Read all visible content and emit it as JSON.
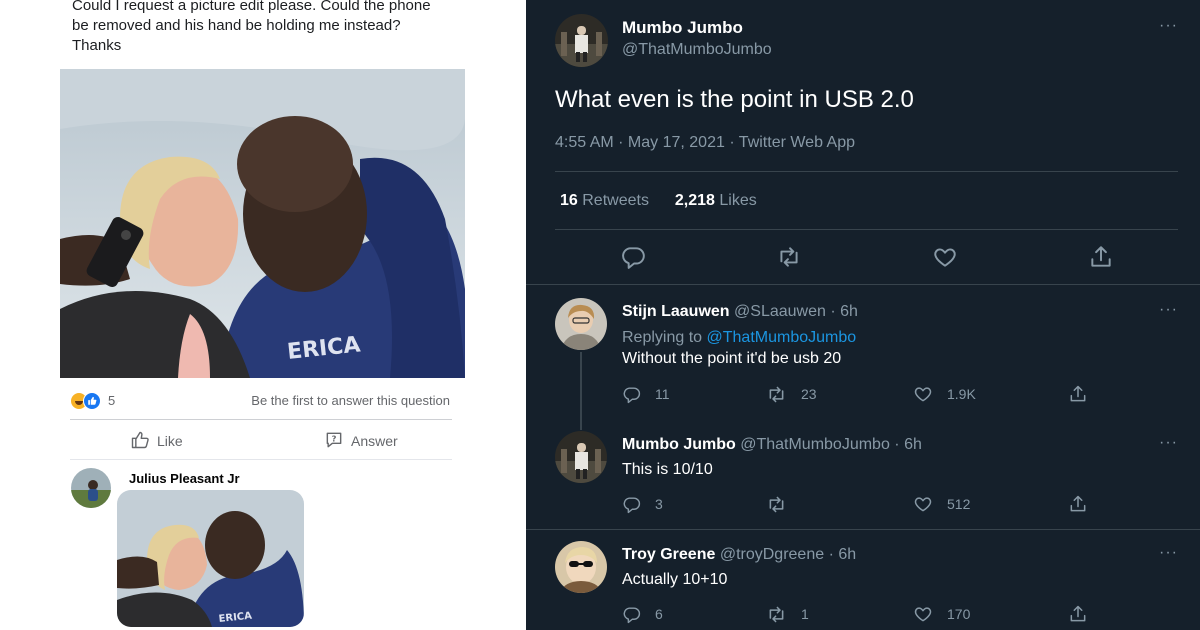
{
  "facebook": {
    "question_lines": [
      "Could I request a picture edit please. Could the phone",
      "be removed and his hand be holding me instead?",
      "Thanks"
    ],
    "reaction_count": "5",
    "answer_prompt": "Be the first to answer this question",
    "like_label": "Like",
    "answer_label": "Answer",
    "comment_author": "Julius Pleasant Jr",
    "icons": [
      "haha-reaction-icon",
      "like-reaction-icon",
      "thumbs-up-icon",
      "question-bubble-icon"
    ]
  },
  "tweet": {
    "author_name": "Mumbo Jumbo",
    "author_handle": "@ThatMumboJumbo",
    "text": "What even is the point in USB 2.0",
    "meta": "4:55 AM · May 17, 2021 · Twitter Web App",
    "retweets_count": "16",
    "retweets_label": "Retweets",
    "likes_count": "2,218",
    "likes_label": "Likes",
    "more_glyph": "···"
  },
  "replies": [
    {
      "name": "Stijn Laauwen",
      "handle_time": "@SLaauwen · 6h",
      "replying_prefix": "Replying to ",
      "replying_to": "@ThatMumboJumbo",
      "text": "Without the point it'd be usb 20",
      "reply_count": "11",
      "retweet_count": "23",
      "like_count": "1.9K"
    },
    {
      "name": "Mumbo Jumbo",
      "handle_time": "@ThatMumboJumbo · 6h",
      "text": "This is 10/10",
      "reply_count": "3",
      "retweet_count": "",
      "like_count": "512"
    },
    {
      "name": "Troy Greene",
      "handle_time": "@troyDgreene · 6h",
      "text": "Actually 10+10",
      "reply_count": "6",
      "retweet_count": "1",
      "like_count": "170"
    }
  ],
  "colors": {
    "twitter_bg": "#15202b",
    "twitter_secondary": "#8899a6",
    "twitter_link": "#1b95e0",
    "twitter_divider": "#38444d",
    "facebook_text": "#1c1e21",
    "facebook_secondary": "#65676b"
  }
}
